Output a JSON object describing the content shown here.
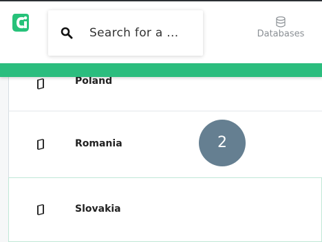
{
  "search": {
    "placeholder": "Search for a ..."
  },
  "nav": {
    "databases_label": "Databases"
  },
  "list": {
    "items": [
      {
        "label": "Poland"
      },
      {
        "label": "Romania"
      },
      {
        "label": "Slovakia"
      }
    ]
  },
  "overlay": {
    "step_number": "2"
  },
  "colors": {
    "accent_green": "#2bbd7e",
    "logo_green": "#27c27a",
    "step_badge": "#657f91"
  },
  "icons": {
    "logo": "app-logo-icon",
    "search": "search-icon",
    "databases": "database-icon",
    "item": "book-icon"
  }
}
